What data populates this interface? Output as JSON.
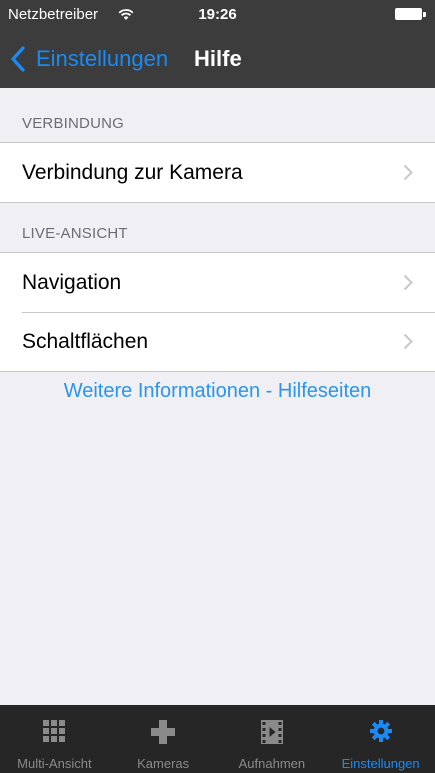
{
  "status_bar": {
    "carrier": "Netzbetreiber",
    "time": "19:26",
    "wifi_icon": "wifi-icon",
    "battery_icon": "battery-icon"
  },
  "navbar": {
    "back_label": "Einstellungen",
    "title": "Hilfe",
    "accent_color": "#1a8bf5"
  },
  "sections": [
    {
      "header": "VERBINDUNG",
      "rows": [
        {
          "label": "Verbindung zur Kamera",
          "icon": "chevron-right-icon"
        }
      ]
    },
    {
      "header": "LIVE-ANSICHT",
      "rows": [
        {
          "label": "Navigation",
          "icon": "chevron-right-icon"
        },
        {
          "label": "Schaltflächen",
          "icon": "chevron-right-icon"
        }
      ]
    }
  ],
  "help_link": "Weitere Informationen - Hilfeseiten",
  "tabbar": {
    "tabs": [
      {
        "label": "Multi-Ansicht",
        "icon": "grid-icon"
      },
      {
        "label": "Kameras",
        "icon": "plus-icon"
      },
      {
        "label": "Aufnahmen",
        "icon": "film-icon"
      },
      {
        "label": "Einstellungen",
        "icon": "gear-icon",
        "active": true
      }
    ]
  }
}
